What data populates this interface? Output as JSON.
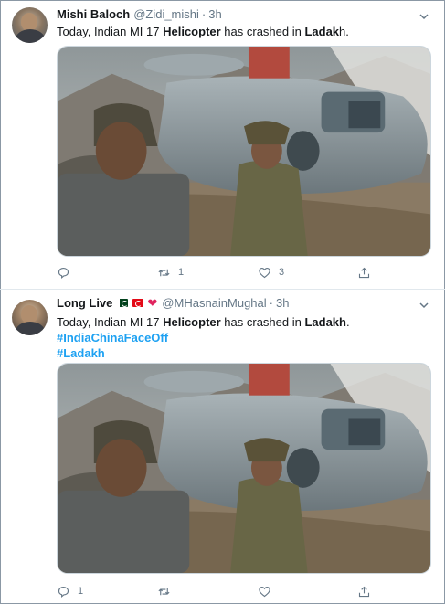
{
  "tweets": [
    {
      "name": "Mishi Baloch",
      "handle": "@Zidi_mishi",
      "dot": "·",
      "time": "3h",
      "text_parts": [
        "Today, Indian MI 17 ",
        "Helicopter",
        " has crashed in ",
        "Ladak",
        "h."
      ],
      "hashtags": [],
      "replies": "",
      "retweets": "1",
      "likes": "3"
    },
    {
      "name": "Long Live",
      "handle": "@MHasnainMughal",
      "dot": "·",
      "time": "3h",
      "text_parts": [
        "Today, Indian MI 17 ",
        "Helicopter",
        " has crashed in ",
        "Ladakh",
        "."
      ],
      "hashtags": [
        "#IndiaChinaFaceOff",
        "#Ladakh"
      ],
      "replies": "1",
      "retweets": "",
      "likes": ""
    }
  ],
  "icons": {
    "reply": "reply-icon",
    "retweet": "retweet-icon",
    "like": "like-icon",
    "share": "share-icon",
    "caret": "chevron-down-icon"
  },
  "colors": {
    "link": "#1da1f2",
    "muted": "#657786",
    "heart": "#e0245e"
  }
}
